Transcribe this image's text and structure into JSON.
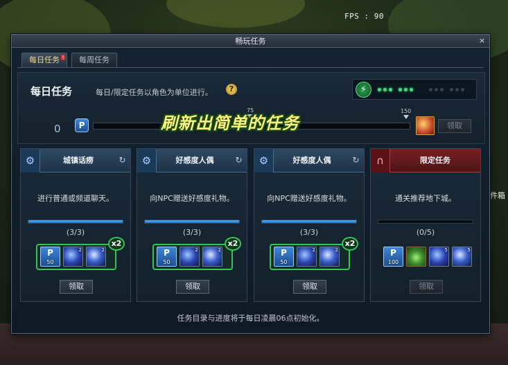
{
  "hud": {
    "fps_label": "FPS : 90",
    "side_text": "件箱"
  },
  "window": {
    "title": "畅玩任务",
    "close_label": "×"
  },
  "tabs": [
    {
      "label": "每日任务",
      "active": true,
      "alert": "!"
    },
    {
      "label": "每周任务",
      "active": false
    }
  ],
  "header": {
    "title": "每日任务",
    "description": "每日/限定任务以角色为单位进行。",
    "help_label": "?",
    "energy_icon": "lightning-icon",
    "pips": {
      "on": 6,
      "off": 6
    }
  },
  "progress": {
    "current": "0",
    "badge": "P",
    "mark_mid": "75",
    "mark_max": "150",
    "fill_fraction": 0,
    "claim_label": "领取"
  },
  "banner": "刷新出简单的任务",
  "cards": [
    {
      "title": "城镇话痨",
      "icon": "gear-icon",
      "desc": "进行普通或频道聊天。",
      "count": "(3/3)",
      "progress_fraction": 1.0,
      "claim_label": "领取",
      "multiplier": "x2",
      "rewards": [
        {
          "type": "p",
          "glyph": "P",
          "label": "50"
        },
        {
          "type": "orb",
          "qty": "2"
        },
        {
          "type": "orb2",
          "qty": "2"
        }
      ]
    },
    {
      "title": "好感度人偶",
      "icon": "gear-icon",
      "desc": "向NPC赠送好感度礼物。",
      "count": "(3/3)",
      "progress_fraction": 1.0,
      "claim_label": "领取",
      "multiplier": "x2",
      "rewards": [
        {
          "type": "p",
          "glyph": "P",
          "label": "50"
        },
        {
          "type": "orb",
          "qty": "2"
        },
        {
          "type": "orb2",
          "qty": "2"
        }
      ]
    },
    {
      "title": "好感度人偶",
      "icon": "gear-icon",
      "desc": "向NPC赠送好感度礼物。",
      "count": "(3/3)",
      "progress_fraction": 1.0,
      "claim_label": "领取",
      "multiplier": "x2",
      "rewards": [
        {
          "type": "p",
          "glyph": "P",
          "label": "50"
        },
        {
          "type": "orb",
          "qty": "2"
        },
        {
          "type": "orb2",
          "qty": "2"
        }
      ]
    },
    {
      "title": "限定任务",
      "icon": "dungeon-gate-icon",
      "desc": "通关推荐地下城。",
      "count": "(0/5)",
      "progress_fraction": 0,
      "claim_label": "领取",
      "multiplier": "",
      "rewards": [
        {
          "type": "p",
          "glyph": "P",
          "label": "100"
        },
        {
          "type": "potion"
        },
        {
          "type": "orb",
          "qty": "5"
        },
        {
          "type": "orb2",
          "qty": "5"
        }
      ]
    }
  ],
  "footer": "任务目录与进度将于每日凌晨06点初始化。"
}
